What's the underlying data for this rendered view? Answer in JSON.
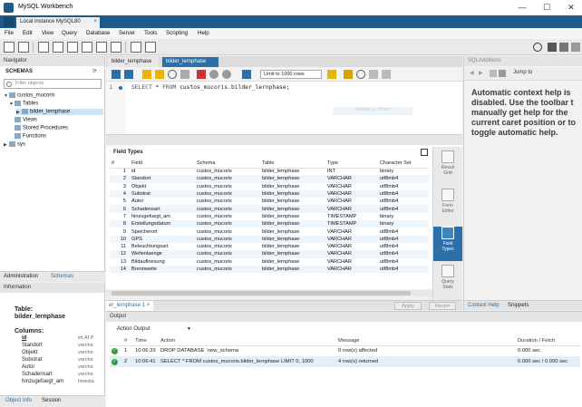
{
  "window": {
    "title": "MySQL Workbench",
    "minimize": "—",
    "maximize": "☐",
    "close": "✕"
  },
  "instance_tab": {
    "label": "Local instance MySQL80",
    "close": "×"
  },
  "menu": [
    "File",
    "Edit",
    "View",
    "Query",
    "Database",
    "Server",
    "Tools",
    "Scripting",
    "Help"
  ],
  "navigator": {
    "header": "Navigator",
    "schemas_label": "SCHEMAS",
    "filter_placeholder": "Filter objects",
    "tree": {
      "schema": "custos_mucoris",
      "tables": "Tables",
      "table": "bilder_lernphase",
      "views": "Views",
      "procedures": "Stored Procedures",
      "functions": "Functions",
      "sys": "sys"
    },
    "tabs": [
      "Administration",
      "Schemas"
    ]
  },
  "information": {
    "header": "Information",
    "table_label": "Table:",
    "table_name": "bilder_lernphase",
    "columns_label": "Columns:",
    "columns": [
      {
        "name": "id",
        "type": "int AI P"
      },
      {
        "name": "Standort",
        "type": "varcha"
      },
      {
        "name": "Objekt",
        "type": "varcha"
      },
      {
        "name": "Substrat",
        "type": "varcha"
      },
      {
        "name": "Autor",
        "type": "varcha"
      },
      {
        "name": "Schadensart",
        "type": "varcha"
      },
      {
        "name": "hinzugefuegt_am",
        "type": "timesta"
      }
    ],
    "tabs": [
      "Object Info",
      "Session"
    ]
  },
  "editor_tabs": [
    "bilder_lernphase",
    "bilder_lernphase"
  ],
  "sql_toolbar": {
    "limit": "Limit to 1000 rows"
  },
  "editor": {
    "line_number": "1",
    "sql_keyword_select": "SELECT",
    "sql_star": " * ",
    "sql_keyword_from": "FROM",
    "sql_rest": " custos_mucoris.bilder_lernphase;",
    "watermark": "Fenster zu öffnen"
  },
  "result": {
    "title": "Field Types",
    "columns": [
      "#",
      "Field",
      "Schema",
      "Table",
      "Type",
      "Character Set"
    ],
    "rows": [
      [
        "1",
        "id",
        "custos_mucoris",
        "bilder_lernphase",
        "INT",
        "binary"
      ],
      [
        "2",
        "Standort",
        "custos_mucoris",
        "bilder_lernphase",
        "VARCHAR",
        "utf8mb4"
      ],
      [
        "3",
        "Objekt",
        "custos_mucoris",
        "bilder_lernphase",
        "VARCHAR",
        "utf8mb4"
      ],
      [
        "4",
        "Substrat",
        "custos_mucoris",
        "bilder_lernphase",
        "VARCHAR",
        "utf8mb4"
      ],
      [
        "5",
        "Autor",
        "custos_mucoris",
        "bilder_lernphase",
        "VARCHAR",
        "utf8mb4"
      ],
      [
        "6",
        "Schadensart",
        "custos_mucoris",
        "bilder_lernphase",
        "VARCHAR",
        "utf8mb4"
      ],
      [
        "7",
        "hinzugefuegt_am",
        "custos_mucoris",
        "bilder_lernphase",
        "TIMESTAMP",
        "binary"
      ],
      [
        "8",
        "Erstellungsdatum",
        "custos_mucoris",
        "bilder_lernphase",
        "TIMESTAMP",
        "binary"
      ],
      [
        "9",
        "Speicherort",
        "custos_mucoris",
        "bilder_lernphase",
        "VARCHAR",
        "utf8mb4"
      ],
      [
        "10",
        "GPS",
        "custos_mucoris",
        "bilder_lernphase",
        "VARCHAR",
        "utf8mb4"
      ],
      [
        "11",
        "Beleuchtungsart",
        "custos_mucoris",
        "bilder_lernphase",
        "VARCHAR",
        "utf8mb4"
      ],
      [
        "12",
        "Wellenlaenge",
        "custos_mucoris",
        "bilder_lernphase",
        "VARCHAR",
        "utf8mb4"
      ],
      [
        "13",
        "Bildaufloesung",
        "custos_mucoris",
        "bilder_lernphase",
        "VARCHAR",
        "utf8mb4"
      ],
      [
        "14",
        "Brennweite",
        "custos_mucoris",
        "bilder_lernphase",
        "VARCHAR",
        "utf8mb4"
      ]
    ],
    "side_buttons": [
      {
        "line1": "Result",
        "line2": "Grid"
      },
      {
        "line1": "Form",
        "line2": "Editor"
      },
      {
        "line1": "Field",
        "line2": "Types"
      },
      {
        "line1": "Query",
        "line2": "Stats"
      }
    ],
    "result_tab": "er_lernphase 1",
    "result_tab_close": "×",
    "apply": "Apply",
    "revert": "Revert"
  },
  "sql_additions": {
    "header": "SQLAdditions",
    "jump_to": "Jump to",
    "help_text": "Automatic context help is\ndisabled. Use the toolbar t\nmanually get help for the\ncurrent caret position or to\ntoggle automatic help.",
    "tabs": [
      "Context Help",
      "Snippets"
    ]
  },
  "output": {
    "header": "Output",
    "selector": "Action Output",
    "columns": [
      "#",
      "Time",
      "Action",
      "Message",
      "Duration / Fetch"
    ],
    "rows": [
      [
        "1",
        "10:06:33",
        "DROP DATABASE `new_schema`",
        "0 row(s) affected",
        "0.000 sec"
      ],
      [
        "2",
        "10:06:41",
        "SELECT * FROM custos_mucoris.bilder_lernphase LIMIT 0, 1000",
        "4 row(s) returned",
        "0.000 sec / 0.000 sec"
      ]
    ],
    "status_icon": "✓"
  },
  "colors": {
    "accent": "#2b70a8",
    "titlebar": "#1e5b8a",
    "ok": "#2e9e3a"
  }
}
